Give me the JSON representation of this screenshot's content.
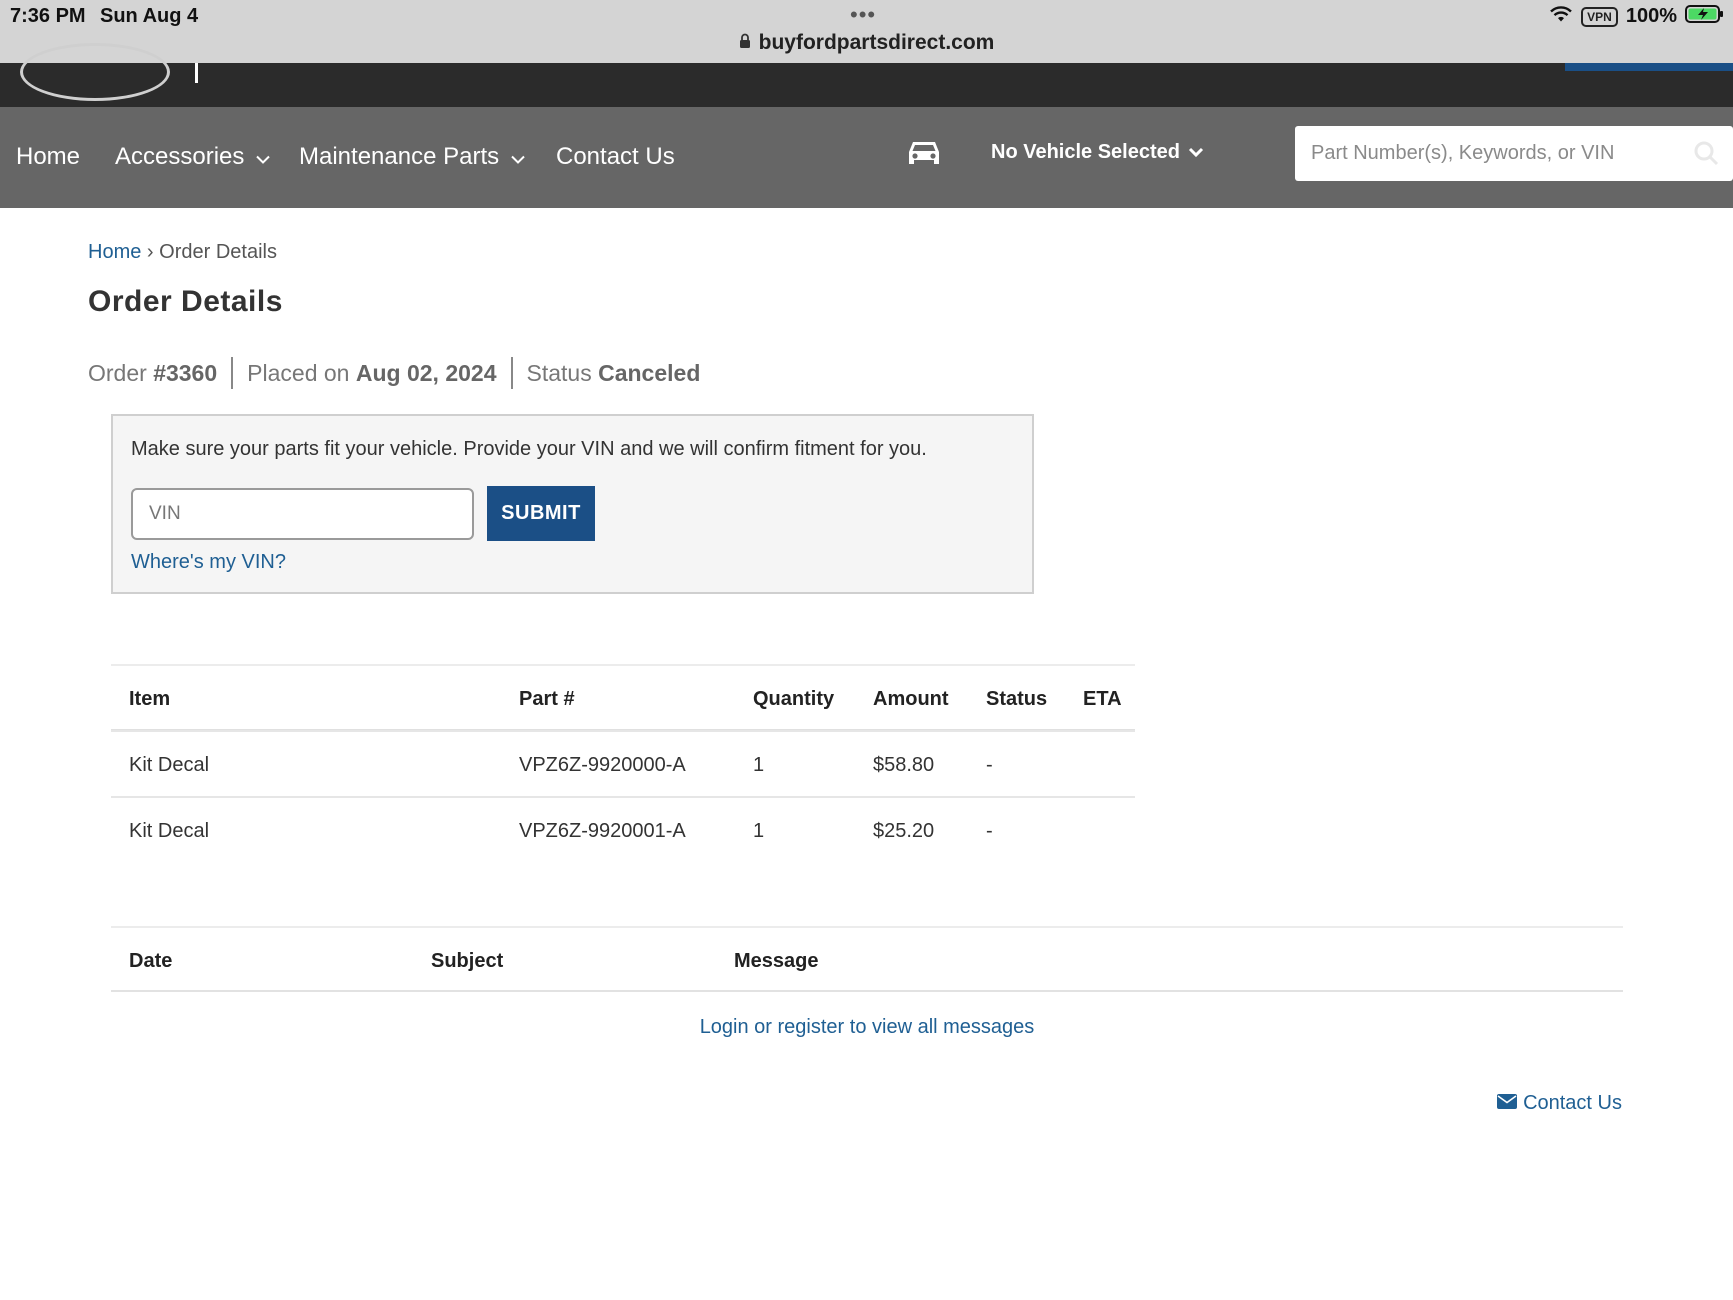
{
  "statusbar": {
    "time": "7:36 PM",
    "date": "Sun Aug 4",
    "url": "buyfordpartsdirect.com",
    "vpn": "VPN",
    "battery": "100%",
    "dots": "•••"
  },
  "nav": {
    "items": [
      {
        "label": "Home",
        "has_dropdown": false
      },
      {
        "label": "Accessories",
        "has_dropdown": true
      },
      {
        "label": "Maintenance Parts",
        "has_dropdown": true
      },
      {
        "label": "Contact Us",
        "has_dropdown": false
      }
    ],
    "vehicle_label": "No Vehicle Selected",
    "search_placeholder": "Part Number(s), Keywords, or VIN"
  },
  "breadcrumb": {
    "home": "Home",
    "separator": "›",
    "current": "Order Details"
  },
  "page_title": "Order Details",
  "order": {
    "order_label": "Order",
    "order_number": "#3360",
    "placed_label": "Placed on",
    "placed_date": "Aug 02, 2024",
    "status_label": "Status",
    "status_value": "Canceled"
  },
  "vin_panel": {
    "message": "Make sure your parts fit your vehicle. Provide your VIN and we will confirm fitment for you.",
    "input_placeholder": "VIN",
    "submit_label": "SUBMIT",
    "help_link": "Where's my VIN?"
  },
  "items_table": {
    "headers": [
      "Item",
      "Part #",
      "Quantity",
      "Amount",
      "Status",
      "ETA"
    ],
    "rows": [
      {
        "item": "Kit Decal",
        "part": "VPZ6Z-9920000-A",
        "quantity": "1",
        "amount": "$58.80",
        "status": "-",
        "eta": ""
      },
      {
        "item": "Kit Decal",
        "part": "VPZ6Z-9920001-A",
        "quantity": "1",
        "amount": "$25.20",
        "status": "-",
        "eta": ""
      }
    ]
  },
  "messages_table": {
    "headers": [
      "Date",
      "Subject",
      "Message"
    ],
    "login_link": "Login or register to view all messages"
  },
  "footer": {
    "contact_label": "Contact Us"
  },
  "colors": {
    "nav_bg": "#666666",
    "brand_strip": "#2b2b2b",
    "accent": "#1b4f86",
    "link": "#1f5f93"
  }
}
